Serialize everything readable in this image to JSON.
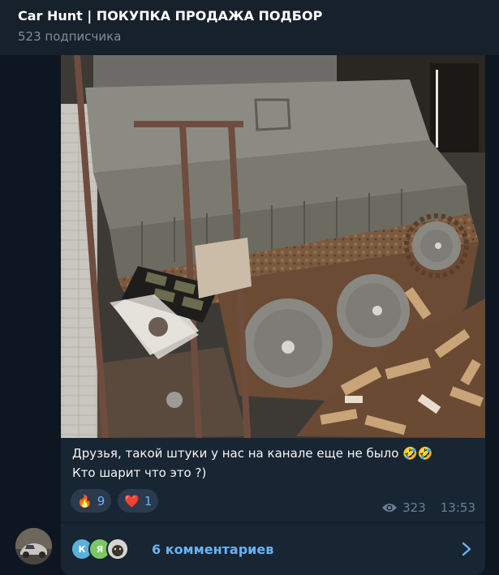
{
  "header": {
    "title": "Car Hunt | ПОКУПКА ПРОДАЖА ПОДБОР",
    "subscribers": "523 подписчика"
  },
  "post": {
    "caption_line1": "Друзья, такой штуки у нас на канале еще не было",
    "caption_emoji": "🤣🤣",
    "caption_line2": "Кто шарит что это ?)",
    "reactions": [
      {
        "icon": "fire-icon",
        "glyph": "🔥",
        "count": "9"
      },
      {
        "icon": "heart-icon",
        "glyph": "❤️",
        "count": "1"
      }
    ],
    "views": "323",
    "time": "13:53"
  },
  "comments": {
    "label": "6 комментариев",
    "avatars": [
      {
        "letter": "К",
        "color": "#5ab0d6"
      },
      {
        "letter": "Я",
        "color": "#7bc862"
      },
      {
        "letter": "",
        "color": "#9a9a9a"
      }
    ]
  },
  "colors": {
    "background": "#0e1621",
    "header": "#17212b",
    "bubble": "#182533",
    "accent": "#6ab3f3",
    "muted": "#6d7f92"
  }
}
